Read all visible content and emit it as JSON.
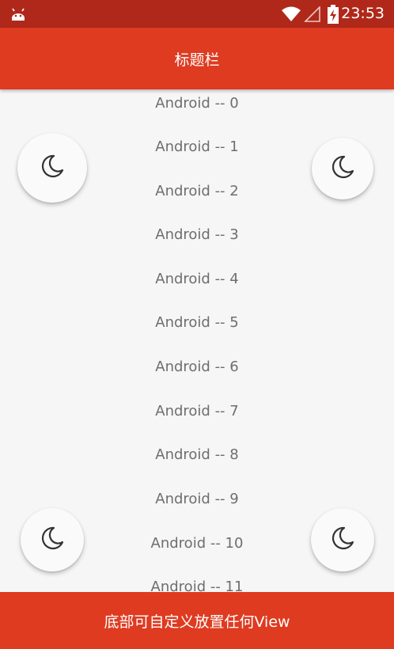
{
  "status_bar": {
    "app_icon": "android-icon",
    "wifi_icon": "wifi-icon",
    "signal_icon": "signal-icon",
    "battery_icon": "battery-charging-icon",
    "time": "23:53"
  },
  "title_bar": {
    "title": "标题栏"
  },
  "list": {
    "items": [
      "Android -- 0",
      "Android -- 1",
      "Android -- 2",
      "Android -- 3",
      "Android -- 4",
      "Android -- 5",
      "Android -- 6",
      "Android -- 7",
      "Android -- 8",
      "Android -- 9",
      "Android -- 10",
      "Android -- 11"
    ]
  },
  "fabs": {
    "icon": "moon-icon"
  },
  "bottom_bar": {
    "text": "底部可自定义放置任何View"
  },
  "colors": {
    "status_bar": "#b0281a",
    "primary": "#de3b21",
    "background": "#f6f6f6",
    "list_text": "#6e6e6e"
  }
}
